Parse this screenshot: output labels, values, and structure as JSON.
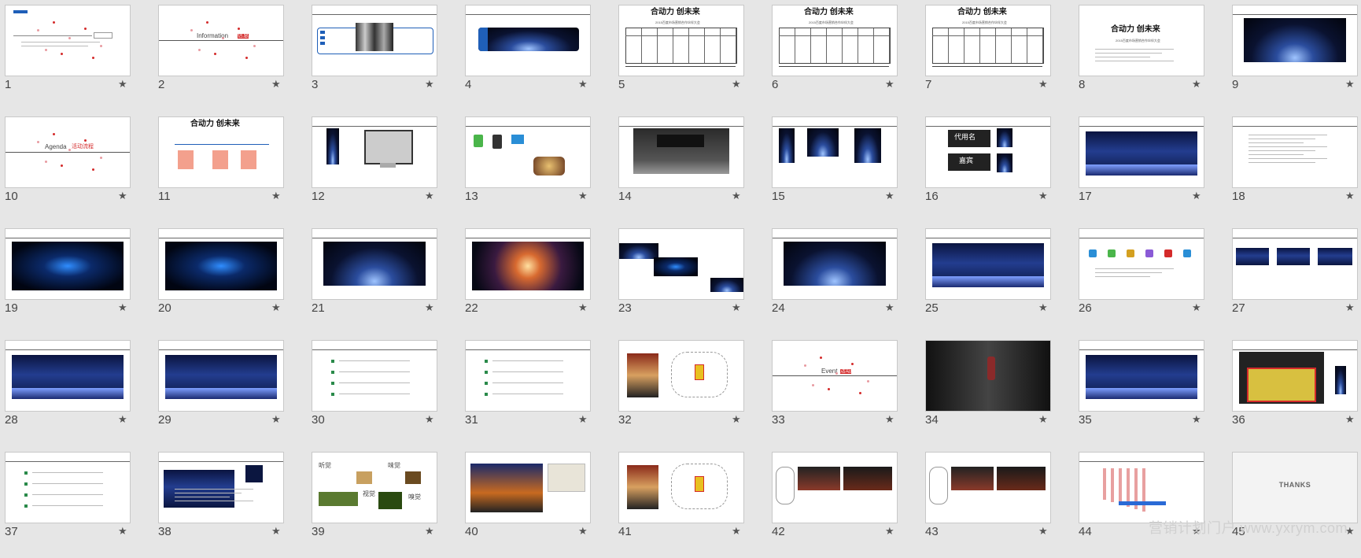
{
  "slides": [
    {
      "number": "1",
      "kind": "title-white"
    },
    {
      "number": "2",
      "kind": "section-information"
    },
    {
      "number": "3",
      "kind": "people"
    },
    {
      "number": "4",
      "kind": "blue-card"
    },
    {
      "number": "5",
      "kind": "table"
    },
    {
      "number": "6",
      "kind": "table"
    },
    {
      "number": "7",
      "kind": "table"
    },
    {
      "number": "8",
      "kind": "text-title"
    },
    {
      "number": "9",
      "kind": "space"
    },
    {
      "number": "10",
      "kind": "section-agenda"
    },
    {
      "number": "11",
      "kind": "salmon-boxes"
    },
    {
      "number": "12",
      "kind": "monitor"
    },
    {
      "number": "13",
      "kind": "devices"
    },
    {
      "number": "14",
      "kind": "gray-stage"
    },
    {
      "number": "15",
      "kind": "banners"
    },
    {
      "number": "16",
      "kind": "signs"
    },
    {
      "number": "17",
      "kind": "stage"
    },
    {
      "number": "18",
      "kind": "text-center"
    },
    {
      "number": "19",
      "kind": "blue-dark"
    },
    {
      "number": "20",
      "kind": "blue-dark"
    },
    {
      "number": "21",
      "kind": "space"
    },
    {
      "number": "22",
      "kind": "space-orange"
    },
    {
      "number": "23",
      "kind": "collage"
    },
    {
      "number": "24",
      "kind": "space"
    },
    {
      "number": "25",
      "kind": "stage"
    },
    {
      "number": "26",
      "kind": "icons"
    },
    {
      "number": "27",
      "kind": "three-screens"
    },
    {
      "number": "28",
      "kind": "stage"
    },
    {
      "number": "29",
      "kind": "stage"
    },
    {
      "number": "30",
      "kind": "text-list"
    },
    {
      "number": "31",
      "kind": "text-list"
    },
    {
      "number": "32",
      "kind": "floorplan"
    },
    {
      "number": "33",
      "kind": "section-event"
    },
    {
      "number": "34",
      "kind": "toast"
    },
    {
      "number": "35",
      "kind": "stage"
    },
    {
      "number": "36",
      "kind": "dark-plan"
    },
    {
      "number": "37",
      "kind": "text-list"
    },
    {
      "number": "38",
      "kind": "stage-side"
    },
    {
      "number": "39",
      "kind": "senses"
    },
    {
      "number": "40",
      "kind": "city-night"
    },
    {
      "number": "41",
      "kind": "floorplan"
    },
    {
      "number": "42",
      "kind": "halls"
    },
    {
      "number": "43",
      "kind": "halls"
    },
    {
      "number": "44",
      "kind": "bars"
    },
    {
      "number": "45",
      "kind": "thanks"
    }
  ],
  "thumbnail_text": {
    "information": "Information",
    "information_cn": "信息",
    "agenda": "Agenda",
    "agenda_cn": "活动流程",
    "event": "Event",
    "event_cn": "活动",
    "slogan": "合动力 创未来",
    "subtitle": "2015百度市场营销合作伙伴大会",
    "thanks": "THANKS",
    "senses": [
      "听觉",
      "味觉",
      "视觉",
      "嗅觉"
    ],
    "signs": [
      "代用名",
      "嘉宾"
    ]
  },
  "star_glyph": "★",
  "watermark": "营销计划门户 www.yxrym.com",
  "colors": {
    "background": "#e6e6e6",
    "thumb_border": "#c8c8c8",
    "accent_red": "#d42a2a",
    "accent_blue": "#1f5fb8"
  }
}
